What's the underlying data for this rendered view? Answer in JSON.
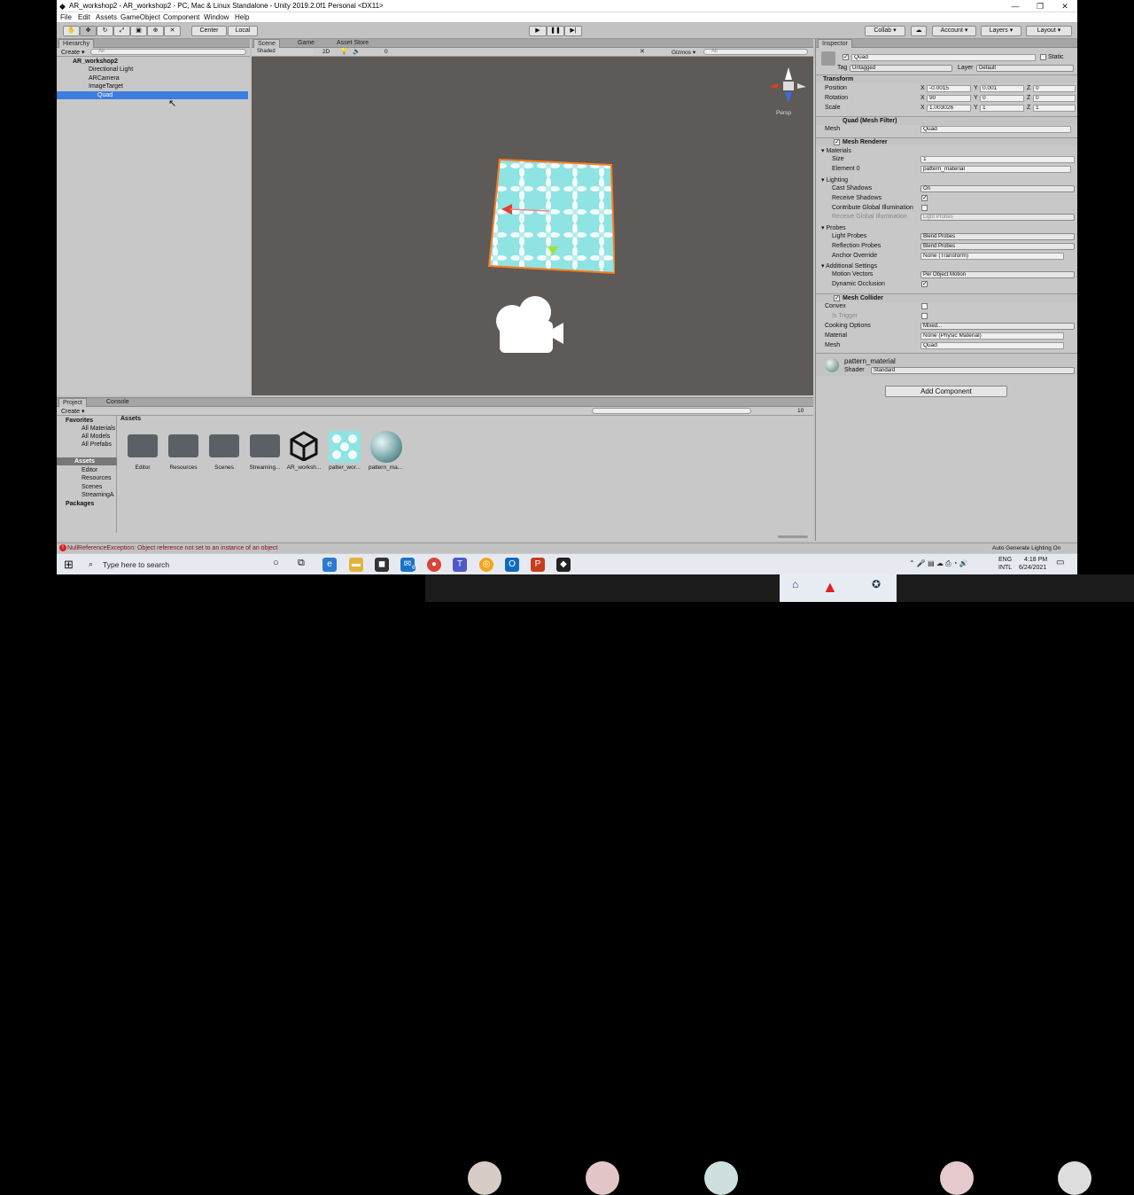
{
  "window": {
    "title": "AR_workshop2 - AR_workshop2 - PC, Mac & Linux Standalone - Unity 2019.2.0f1 Personal <DX11>",
    "controls": [
      "—",
      "❐",
      "✕"
    ]
  },
  "menu": [
    "File",
    "Edit",
    "Assets",
    "GameObject",
    "Component",
    "Window",
    "Help"
  ],
  "toolbar": {
    "pivot": "Center",
    "space": "Local",
    "collab": "Collab",
    "account": "Account",
    "layers": "Layers",
    "layout": "Layout"
  },
  "hierarchy": {
    "tab": "Hierarchy",
    "create": "Create",
    "search_placeholder": "All",
    "items": [
      {
        "label": "AR_workshop2",
        "level": 0
      },
      {
        "label": "Directional Light",
        "level": 2
      },
      {
        "label": "ARCamera",
        "level": 2
      },
      {
        "label": "ImageTarget",
        "level": 2
      },
      {
        "label": "Quad",
        "level": 3,
        "selected": true
      }
    ]
  },
  "scene": {
    "tabs": [
      "Scene",
      "Game",
      "Asset Store"
    ],
    "shading": "Shaded",
    "mode_2d": "2D",
    "gizmos": "Gizmos",
    "search_placeholder": "All",
    "fx_count": "0",
    "persp": "Persp"
  },
  "inspector": {
    "tab": "Inspector",
    "object_name": "Quad",
    "static_label": "Static",
    "tag_label": "Tag",
    "tag_value": "Untagged",
    "layer_label": "Layer",
    "layer_value": "Default",
    "transform": {
      "title": "Transform",
      "position": {
        "label": "Position",
        "x": "-0.0015",
        "y": "0.001",
        "z": "0"
      },
      "rotation": {
        "label": "Rotation",
        "x": "90",
        "y": "0",
        "z": "0"
      },
      "scale": {
        "label": "Scale",
        "x": "1.003026",
        "y": "1",
        "z": "1"
      }
    },
    "mesh_filter": {
      "title": "Quad (Mesh Filter)",
      "mesh_label": "Mesh",
      "mesh_value": "Quad"
    },
    "mesh_renderer": {
      "title": "Mesh Renderer",
      "materials": "Materials",
      "size_label": "Size",
      "size_value": "1",
      "element0_label": "Element 0",
      "element0_value": "pattern_material",
      "lighting": "Lighting",
      "cast_shadows_label": "Cast Shadows",
      "cast_shadows_value": "On",
      "receive_shadows_label": "Receive Shadows",
      "contribute_gi_label": "Contribute Global Illumination",
      "receive_gi_label": "Receive Global Illumination",
      "receive_gi_value": "Light Probes",
      "probes": "Probes",
      "light_probes_label": "Light Probes",
      "light_probes_value": "Blend Probes",
      "reflection_probes_label": "Reflection Probes",
      "reflection_probes_value": "Blend Probes",
      "anchor_override_label": "Anchor Override",
      "anchor_override_value": "None (Transform)",
      "additional_settings": "Additional Settings",
      "motion_vectors_label": "Motion Vectors",
      "motion_vectors_value": "Per Object Motion",
      "dynamic_occlusion_label": "Dynamic Occlusion"
    },
    "mesh_collider": {
      "title": "Mesh Collider",
      "convex_label": "Convex",
      "is_trigger_label": "Is Trigger",
      "cooking_label": "Cooking Options",
      "cooking_value": "Mixed...",
      "material_label": "Material",
      "material_value": "None (Physic Material)",
      "mesh_label": "Mesh",
      "mesh_value": "Quad"
    },
    "material": {
      "name": "pattern_material",
      "shader_label": "Shader",
      "shader_value": "Standard"
    },
    "add_component": "Add Component"
  },
  "project": {
    "tabs": [
      "Project",
      "Console"
    ],
    "create": "Create",
    "count": "10",
    "tree": [
      {
        "label": "Favorites",
        "bold": true
      },
      {
        "label": "All Materials"
      },
      {
        "label": "All Models"
      },
      {
        "label": "All Prefabs"
      },
      {
        "label": "Assets",
        "bold": true,
        "selected": true
      },
      {
        "label": "Editor"
      },
      {
        "label": "Resources"
      },
      {
        "label": "Scenes"
      },
      {
        "label": "StreamingA"
      },
      {
        "label": "Packages",
        "bold": true
      }
    ],
    "breadcrumb": "Assets",
    "assets": [
      {
        "label": "Editor",
        "kind": "folder"
      },
      {
        "label": "Resources",
        "kind": "folder"
      },
      {
        "label": "Scenes",
        "kind": "folder"
      },
      {
        "label": "Streaming...",
        "kind": "folder"
      },
      {
        "label": "AR_worksh...",
        "kind": "unity"
      },
      {
        "label": "patter_wor...",
        "kind": "texture"
      },
      {
        "label": "pattern_ma...",
        "kind": "material"
      }
    ]
  },
  "status": {
    "error": "NullReferenceException: Object reference not set to an instance of an object",
    "right": "Auto Generate Lighting On"
  },
  "taskbar": {
    "search_placeholder": "Type here to search",
    "lang": "ENG",
    "lang2": "INTL",
    "time": "4:18 PM",
    "date": "6/24/2021",
    "badge": "6"
  }
}
